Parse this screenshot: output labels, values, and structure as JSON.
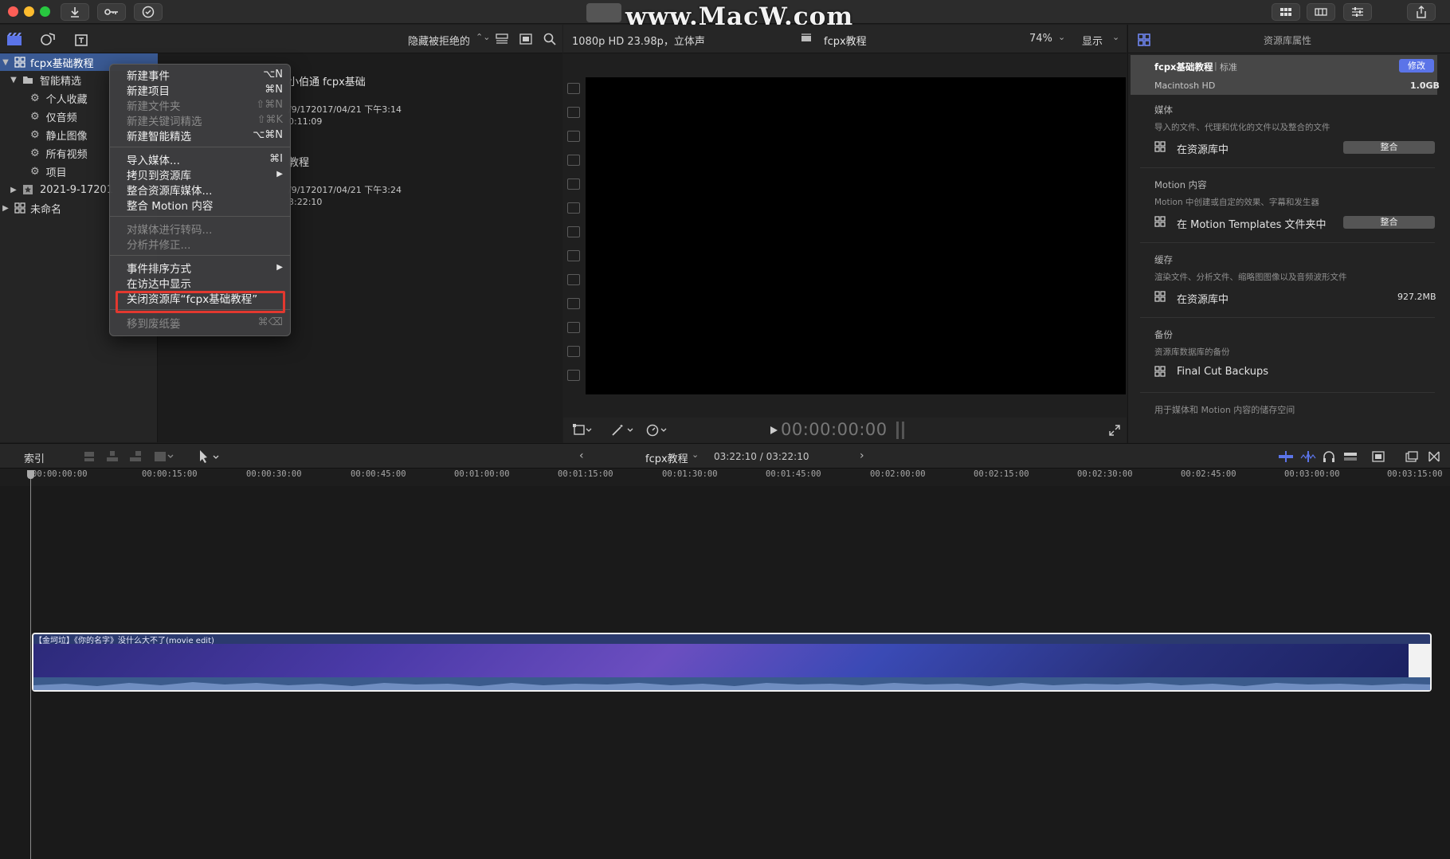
{
  "watermark": "www.MacW.com",
  "library_toolbar": {
    "filter_label": "隐藏被拒绝的"
  },
  "sidebar": {
    "items": [
      {
        "label": "fcpx基础教程",
        "kind": "library"
      },
      {
        "label": "智能精选",
        "kind": "folder"
      },
      {
        "label": "个人收藏",
        "kind": "smart"
      },
      {
        "label": "仅音频",
        "kind": "smart"
      },
      {
        "label": "静止图像",
        "kind": "smart"
      },
      {
        "label": "所有视频",
        "kind": "smart"
      },
      {
        "label": "项目",
        "kind": "smart"
      },
      {
        "label": "2021-9-17201",
        "kind": "event"
      },
      {
        "label": "未命名",
        "kind": "library"
      }
    ]
  },
  "browser": {
    "items": [
      {
        "name": "小伯通 fcpx基础",
        "date": "/9/172017/04/21 下午3:14",
        "duration": "0:11:09"
      },
      {
        "name": "教程",
        "date": "/9/172017/04/21 下午3:24",
        "duration": "3:22:10"
      }
    ]
  },
  "context_menu": {
    "items": [
      {
        "label": "新建事件",
        "shortcut": "⌥N",
        "enabled": true
      },
      {
        "label": "新建项目",
        "shortcut": "⌘N",
        "enabled": true
      },
      {
        "label": "新建文件夹",
        "shortcut": "⇧⌘N",
        "enabled": false
      },
      {
        "label": "新建关键词精选",
        "shortcut": "⇧⌘K",
        "enabled": false
      },
      {
        "label": "新建智能精选",
        "shortcut": "⌥⌘N",
        "enabled": true
      },
      {
        "label": "导入媒体...",
        "shortcut": "⌘I",
        "enabled": true
      },
      {
        "label": "拷贝到资源库",
        "shortcut": "▶",
        "enabled": true
      },
      {
        "label": "整合资源库媒体...",
        "shortcut": "",
        "enabled": true
      },
      {
        "label": "整合 Motion 内容",
        "shortcut": "",
        "enabled": true
      },
      {
        "label": "对媒体进行转码...",
        "shortcut": "",
        "enabled": false
      },
      {
        "label": "分析并修正...",
        "shortcut": "",
        "enabled": false
      },
      {
        "label": "事件排序方式",
        "shortcut": "▶",
        "enabled": true
      },
      {
        "label": "在访达中显示",
        "shortcut": "",
        "enabled": true
      },
      {
        "label": "关闭资源库“fcpx基础教程”",
        "shortcut": "",
        "enabled": true
      },
      {
        "label": "移到废纸篓",
        "shortcut": "⌘⌫",
        "enabled": false
      }
    ]
  },
  "viewer": {
    "format": "1080p HD 23.98p，立体声",
    "title": "fcpx教程",
    "zoom": "74%",
    "display_label": "显示",
    "timecode": "00:00:00:00"
  },
  "inspector": {
    "title": "资源库属性",
    "library_name": "fcpx基础教程",
    "library_type": "标准",
    "modify_label": "修改",
    "volume": "Macintosh HD",
    "volume_size": "1.0GB",
    "sections": [
      {
        "heading": "媒体",
        "desc": "导入的文件、代理和优化的文件以及整合的文件",
        "location": "在资源库中",
        "action": "整合",
        "value": ""
      },
      {
        "heading": "Motion 内容",
        "desc": "Motion 中创建或自定的效果、字幕和发生器",
        "location": "在 Motion Templates 文件夹中",
        "action": "整合",
        "value": ""
      },
      {
        "heading": "缓存",
        "desc": "渲染文件、分析文件、缩略图图像以及音频波形文件",
        "location": "在资源库中",
        "action": "",
        "value": "927.2MB"
      },
      {
        "heading": "备份",
        "desc": "资源库数据库的备份",
        "location": "Final Cut Backups",
        "action": "",
        "value": ""
      }
    ],
    "footer": "用于媒体和 Motion 内容的储存空间"
  },
  "timeline": {
    "index_label": "索引",
    "project_name": "fcpx教程",
    "duration": "03:22:10 / 03:22:10",
    "ruler_ticks": [
      "00:00:00:00",
      "00:00:15:00",
      "00:00:30:00",
      "00:00:45:00",
      "00:01:00:00",
      "00:01:15:00",
      "00:01:30:00",
      "00:01:45:00",
      "00:02:00:00",
      "00:02:15:00",
      "00:02:30:00",
      "00:02:45:00",
      "00:03:00:00",
      "00:03:15:00"
    ],
    "clip_title": "【金坷垃】《你的名字》没什么大不了(movie edit)"
  },
  "colors": {
    "selection": "#3a5a94",
    "highlight_box": "#e2382f",
    "accent_blue": "#5b74e8",
    "clip_fill": "#2b3a6e"
  }
}
